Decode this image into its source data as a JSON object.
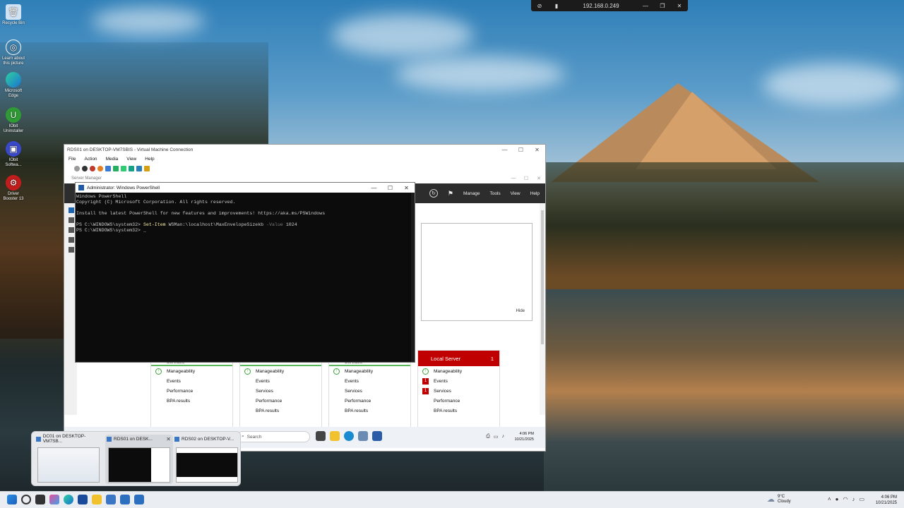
{
  "desktop": {
    "icons": [
      {
        "label": "Recycle Bin",
        "icon": "recycle-bin-icon"
      },
      {
        "label": "Learn about this picture",
        "icon": "camera-icon"
      },
      {
        "label": "Microsoft Edge",
        "icon": "edge-icon"
      },
      {
        "label": "IObit Uninstaller",
        "icon": "uninstaller-icon"
      },
      {
        "label": "IObit Softwa...",
        "icon": "iobit-icon"
      },
      {
        "label": "Driver Booster 13",
        "icon": "driver-booster-icon"
      }
    ]
  },
  "rdp_bar": {
    "ip": "192.168.0.249"
  },
  "vm_window": {
    "title": "RDS01 on DESKTOP-VM7SBIS - Virtual Machine Connection",
    "menu": [
      "File",
      "Action",
      "Media",
      "View",
      "Help"
    ]
  },
  "server_manager": {
    "title": "Server Manager",
    "nav": [
      "Manage",
      "Tools",
      "View",
      "Help"
    ],
    "hide_label": "Hide",
    "tiles": [
      {
        "title": "Services",
        "rows": [
          "Manageability",
          "Events",
          "Performance",
          "BPA results"
        ]
      },
      {
        "title": "",
        "rows": [
          "Manageability",
          "Events",
          "Services",
          "Performance",
          "BPA results"
        ]
      },
      {
        "title": "Services",
        "rows": [
          "Manageability",
          "Events",
          "Services",
          "Performance",
          "BPA results"
        ]
      },
      {
        "title": "Local Server",
        "count": "1",
        "rows": [
          "Manageability",
          "Events",
          "Services",
          "Performance",
          "BPA results"
        ],
        "badges": [
          "1",
          "1"
        ]
      }
    ]
  },
  "powershell": {
    "title": "Administrator: Windows PowerShell",
    "lines": [
      "Windows PowerShell",
      "Copyright (C) Microsoft Corporation. All rights reserved.",
      "",
      "Install the latest PowerShell for new features and improvements! https://aka.ms/PSWindows",
      ""
    ],
    "prompt": "PS C:\\WINDOWS\\system32>",
    "cmd_name": "Set-Item",
    "cmd_path": "WSMan:\\localhost\\MaxEnvelopeSizekb",
    "cmd_param": "-Value",
    "cmd_value": "1024",
    "cursor": "_"
  },
  "vm_taskbar": {
    "search_placeholder": "Search",
    "time": "4:06 PM",
    "date": "10/21/2025"
  },
  "thumbnails": [
    {
      "title": "DC01 on DESKTOP-VM7SB..."
    },
    {
      "title": "RDS01 on DESK...",
      "close": "✕"
    },
    {
      "title": "RDS02 on DESKTOP-V..."
    }
  ],
  "taskbar": {
    "weather_temp": "9°C",
    "weather_desc": "Cloudy",
    "time": "4:06 PM",
    "date": "10/21/2025"
  }
}
